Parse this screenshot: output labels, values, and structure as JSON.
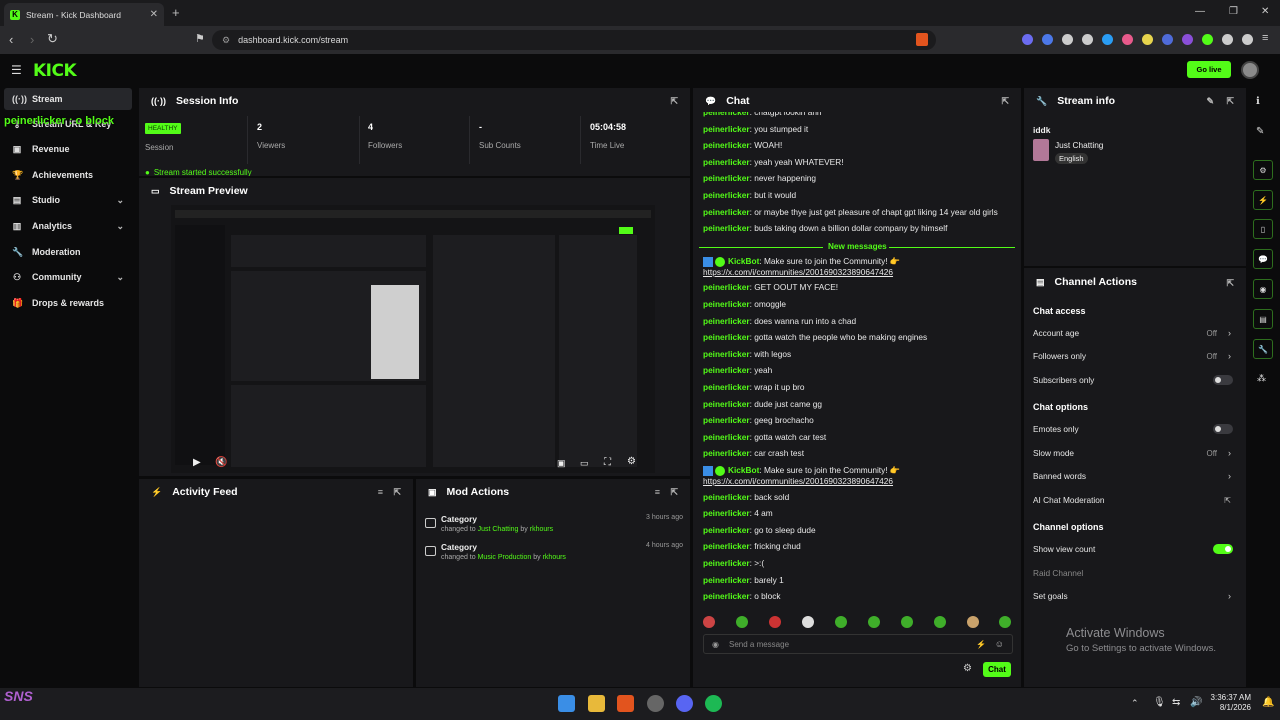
{
  "browser": {
    "tab_title": "Stream - Kick Dashboard",
    "url": "dashboard.kick.com/stream"
  },
  "header": {
    "logo": "KICK",
    "go_live": "Go live"
  },
  "overlay_text": "peinerlicker : o block",
  "sidebar": {
    "items": [
      {
        "label": "Stream",
        "icon": "broadcast-icon"
      },
      {
        "label": "Stream URL & Key",
        "icon": "key-icon"
      },
      {
        "label": "Revenue",
        "icon": "revenue-icon"
      },
      {
        "label": "Achievements",
        "icon": "trophy-icon"
      },
      {
        "label": "Studio",
        "icon": "studio-icon"
      },
      {
        "label": "Analytics",
        "icon": "analytics-icon"
      },
      {
        "label": "Moderation",
        "icon": "wrench-icon"
      },
      {
        "label": "Community",
        "icon": "community-icon"
      },
      {
        "label": "Drops & rewards",
        "icon": "gift-icon"
      }
    ]
  },
  "session": {
    "title": "Session Info",
    "health": "HEALTHY",
    "health_label": "Session",
    "viewers": "2",
    "viewers_label": "Viewers",
    "followers": "4",
    "followers_label": "Followers",
    "subs": "-",
    "subs_label": "Sub Counts",
    "time": "05:04:58",
    "time_label": "Time Live",
    "toast": "Stream started successfully"
  },
  "preview": {
    "title": "Stream Preview"
  },
  "activity": {
    "title": "Activity Feed"
  },
  "mod_actions": {
    "title": "Mod Actions",
    "items": [
      {
        "title": "Category",
        "pre": "changed to ",
        "value": "Just Chatting",
        "by": " by ",
        "user": "rkhours",
        "ago": "3 hours ago"
      },
      {
        "title": "Category",
        "pre": "changed to ",
        "value": "Music Production",
        "by": " by ",
        "user": "rkhours",
        "ago": "4 hours ago"
      }
    ]
  },
  "chat": {
    "title": "Chat",
    "new_messages": "New messages",
    "input_placeholder": "Send a message",
    "send": "Chat",
    "messages": [
      {
        "user": "peinerlicker",
        "text": ": chatgpt lookin ahh"
      },
      {
        "user": "peinerlicker",
        "text": ": you stumped it"
      },
      {
        "user": "peinerlicker",
        "text": ": WOAH!"
      },
      {
        "user": "peinerlicker",
        "text": ": yeah yeah WHATEVER!"
      },
      {
        "user": "peinerlicker",
        "text": ": never happening"
      },
      {
        "user": "peinerlicker",
        "text": ": but it would"
      },
      {
        "user": "peinerlicker",
        "text": ": or maybe thye just get pleasure of chapt gpt liking 14 year old girls"
      },
      {
        "user": "peinerlicker",
        "text": ": buds taking down a billion dollar company by himself"
      },
      {
        "user": "KickBot",
        "text": ": Make sure to join the Community! 👉",
        "link": "https://x.com/i/communities/2001690323890647426"
      },
      {
        "user": "peinerlicker",
        "text": ": GET OOUT MY FACE!"
      },
      {
        "user": "peinerlicker",
        "text": ": omoggle"
      },
      {
        "user": "peinerlicker",
        "text": ": does wanna run into a chad"
      },
      {
        "user": "peinerlicker",
        "text": ": gotta watch the people who be making engines"
      },
      {
        "user": "peinerlicker",
        "text": ": with legos"
      },
      {
        "user": "peinerlicker",
        "text": ": yeah"
      },
      {
        "user": "peinerlicker",
        "text": ": wrap it up bro"
      },
      {
        "user": "peinerlicker",
        "text": ": dude just came gg"
      },
      {
        "user": "peinerlicker",
        "text": ": geeg brochacho"
      },
      {
        "user": "peinerlicker",
        "text": ": gotta watch car test"
      },
      {
        "user": "peinerlicker",
        "text": ": car crash test"
      },
      {
        "user": "KickBot",
        "text": ": Make sure to join the Community! 👉",
        "link": "https://x.com/i/communities/2001690323890647426"
      },
      {
        "user": "peinerlicker",
        "text": ": back sold"
      },
      {
        "user": "peinerlicker",
        "text": ": 4 am"
      },
      {
        "user": "peinerlicker",
        "text": ": go to sleep dude"
      },
      {
        "user": "peinerlicker",
        "text": ": fricking chud"
      },
      {
        "user": "peinerlicker",
        "text": ": >:("
      },
      {
        "user": "peinerlicker",
        "text": ": barely 1"
      },
      {
        "user": "peinerlicker",
        "text": ": o block"
      }
    ]
  },
  "stream_info": {
    "title": "Stream info",
    "stream_title": "iddk",
    "category": "Just Chatting",
    "language": "English"
  },
  "channel_actions": {
    "title": "Channel Actions",
    "chat_access": "Chat access",
    "account_age": "Account age",
    "account_age_val": "Off",
    "followers_only": "Followers only",
    "followers_only_val": "Off",
    "subscribers_only": "Subscribers only",
    "chat_options": "Chat options",
    "emotes_only": "Emotes only",
    "slow_mode": "Slow mode",
    "slow_mode_val": "Off",
    "banned_words": "Banned words",
    "ai_mod": "AI Chat Moderation",
    "channel_options": "Channel options",
    "show_view_count": "Show view count",
    "raid_channel": "Raid Channel",
    "set_goals": "Set goals"
  },
  "windows": {
    "activate_1": "Activate Windows",
    "activate_2": "Go to Settings to activate Windows.",
    "time": "3:36:37 AM",
    "date": "8/1/2026"
  },
  "colors": {
    "accent": "#53fc18",
    "panel": "#18181b",
    "bg": "#0b0b0c"
  }
}
